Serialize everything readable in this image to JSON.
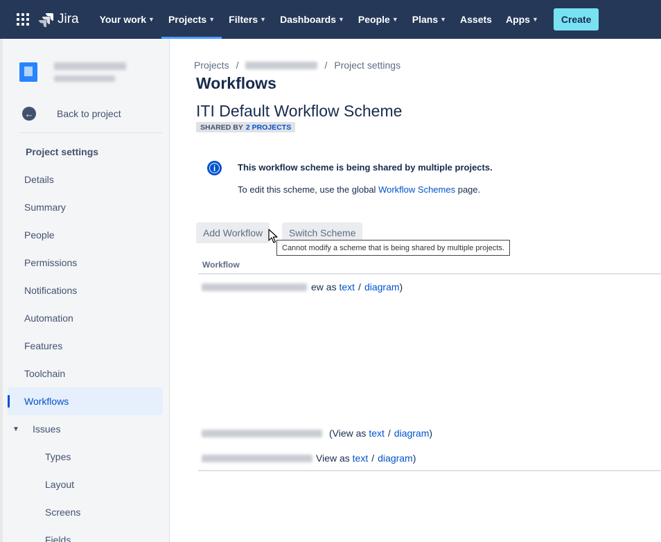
{
  "nav": {
    "logo_text": "Jira",
    "items": [
      {
        "label": "Your work",
        "dropdown": true,
        "active": false
      },
      {
        "label": "Projects",
        "dropdown": true,
        "active": true
      },
      {
        "label": "Filters",
        "dropdown": true,
        "active": false
      },
      {
        "label": "Dashboards",
        "dropdown": true,
        "active": false
      },
      {
        "label": "People",
        "dropdown": true,
        "active": false
      },
      {
        "label": "Plans",
        "dropdown": true,
        "active": false
      },
      {
        "label": "Assets",
        "dropdown": false,
        "active": false
      },
      {
        "label": "Apps",
        "dropdown": true,
        "active": false
      }
    ],
    "create_label": "Create"
  },
  "sidebar": {
    "back_label": "Back to project",
    "section_title": "Project settings",
    "items": [
      {
        "label": "Details"
      },
      {
        "label": "Summary"
      },
      {
        "label": "People"
      },
      {
        "label": "Permissions"
      },
      {
        "label": "Notifications"
      },
      {
        "label": "Automation"
      },
      {
        "label": "Features"
      },
      {
        "label": "Toolchain"
      },
      {
        "label": "Workflows"
      },
      {
        "label": "Issues"
      },
      {
        "label": "Types"
      },
      {
        "label": "Layout"
      },
      {
        "label": "Screens"
      },
      {
        "label": "Fields"
      }
    ]
  },
  "breadcrumb": {
    "first": "Projects",
    "last": "Project settings"
  },
  "page": {
    "title": "Workflows",
    "scheme_name": "ITI Default Workflow Scheme",
    "shared_prefix": "SHARED BY",
    "shared_link": "2 PROJECTS"
  },
  "info": {
    "title": "This workflow scheme is being shared by multiple projects.",
    "body_prefix": "To edit this scheme, use the global",
    "body_link": "Workflow Schemes",
    "body_suffix": "page."
  },
  "buttons": {
    "add": "Add Workflow",
    "switch": "Switch Scheme"
  },
  "tooltip": "Cannot modify a scheme that is being shared by multiple projects.",
  "table": {
    "column": "Workflow",
    "rows": [
      {
        "prefix": "ew as",
        "text_link": "text",
        "slash": "/",
        "diagram_link": "diagram",
        "suffix": ")"
      },
      {
        "prefix": "(View as",
        "text_link": "text",
        "slash": "/",
        "diagram_link": "diagram",
        "suffix": ")"
      },
      {
        "prefix": "View as",
        "text_link": "text",
        "slash": "/",
        "diagram_link": "diagram",
        "suffix": ")"
      }
    ]
  }
}
